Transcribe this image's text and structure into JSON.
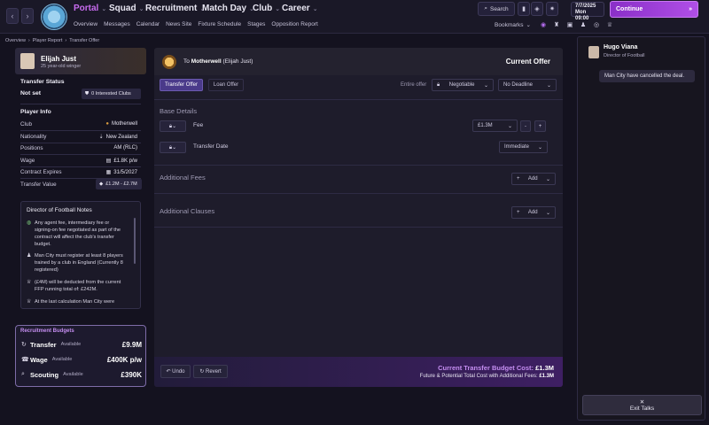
{
  "header": {
    "menus": [
      "Portal",
      "Squad",
      "Recruitment",
      "Match Day",
      "Club",
      "Career"
    ],
    "submenu": [
      "Overview",
      "Messages",
      "Calendar",
      "News Site",
      "Fixture Schedule",
      "Stages",
      "Opposition Report"
    ],
    "search_label": "Search",
    "date_line1": "7/7/2025",
    "date_line2_day": "Mon",
    "date_line2_time": "09:00",
    "continue_label": "Continue",
    "bookmarks_label": "Bookmarks",
    "accent": "#b04fe6"
  },
  "breadcrumb": [
    "Overview",
    "Player Report",
    "Transfer Offer"
  ],
  "player": {
    "name": "Elijah Just",
    "subtitle": "25 year-old winger"
  },
  "transfer_status": {
    "heading": "Transfer Status",
    "value": "Not set",
    "interested": "0 Interested Clubs"
  },
  "player_info": {
    "heading": "Player Info",
    "rows": [
      {
        "label": "Club",
        "value": "Motherwell"
      },
      {
        "label": "Nationality",
        "value": "New Zealand"
      },
      {
        "label": "Positions",
        "value": "AM (RLC)"
      },
      {
        "label": "Wage",
        "value": "£1.8K p/w"
      },
      {
        "label": "Contract Expires",
        "value": "31/5/2027"
      },
      {
        "label": "Transfer Value",
        "value": "£1.2M - £2.7M"
      }
    ]
  },
  "dof_notes": {
    "heading": "Director of Football Notes",
    "notes": [
      "Any agent fee, intermediary fee or signing-on fee negotiated as part of the contract will affect the club's transfer budget.",
      "Man City must register at least 8 players trained by a club in England (Currently 8 registered)",
      "(£4M) will be deducted from the current FFP running total of: £242M.",
      "At the last calculation Man City were"
    ]
  },
  "budgets": {
    "heading": "Recruitment Budgets",
    "rows": [
      {
        "name": "Transfer",
        "status": "Available",
        "value": "£9.9M"
      },
      {
        "name": "Wage",
        "status": "Available",
        "value": "£400K p/w"
      },
      {
        "name": "Scouting",
        "status": "Available",
        "value": "£390K"
      }
    ]
  },
  "offer": {
    "to_prefix": "To",
    "club": "Motherwell",
    "player_paren": "(Elijah Just)",
    "title": "Current Offer",
    "tabs": [
      "Transfer Offer",
      "Loan Offer"
    ],
    "entire_offer_label": "Entire offer",
    "negotiable": "Negotiable",
    "deadline": "No Deadline",
    "base_details": "Base Details",
    "fee_label": "Fee",
    "fee_value": "£1.3M",
    "transfer_date_label": "Transfer Date",
    "transfer_date_value": "Immediate",
    "additional_fees": "Additional Fees",
    "additional_clauses": "Additional Clauses",
    "add_label": "Add",
    "undo_label": "Undo",
    "revert_label": "Revert",
    "budget_cost_label": "Current Transfer Budget Cost:",
    "budget_cost_value": "£1.3M",
    "future_cost_label": "Future & Potential Total Cost with Additional Fees:",
    "future_cost_value": "£1.3M"
  },
  "chat": {
    "name": "Hugo Viana",
    "role": "Director of Football",
    "message": "Man City have cancelled the deal.",
    "exit_label": "Exit Talks"
  }
}
